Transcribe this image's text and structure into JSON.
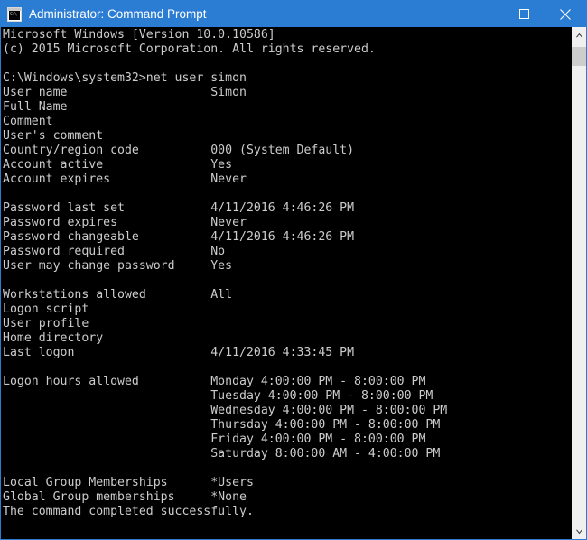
{
  "window": {
    "title": "Administrator: Command Prompt",
    "icon": "command-prompt-icon",
    "icon_glyph": "C:\\",
    "accent_color": "#2b7cd3",
    "terminal_bg": "#000000",
    "terminal_fg": "#cccccc",
    "controls": {
      "minimize_label": "Minimize",
      "maximize_label": "Maximize",
      "close_label": "Close"
    }
  },
  "scrollbar": {
    "up_arrow_label": "Scroll up",
    "down_arrow_label": "Scroll down",
    "thumb_label": "Scroll thumb"
  },
  "terminal": {
    "banner": [
      "Microsoft Windows [Version 10.0.10586]",
      "(c) 2015 Microsoft Corporation. All rights reserved."
    ],
    "prompt": "C:\\Windows\\system32>",
    "command": "net user simon",
    "fields": [
      {
        "label": "User name",
        "value": "Simon"
      },
      {
        "label": "Full Name",
        "value": ""
      },
      {
        "label": "Comment",
        "value": ""
      },
      {
        "label": "User's comment",
        "value": ""
      },
      {
        "label": "Country/region code",
        "value": "000 (System Default)"
      },
      {
        "label": "Account active",
        "value": "Yes"
      },
      {
        "label": "Account expires",
        "value": "Never"
      },
      {
        "label": "",
        "value": ""
      },
      {
        "label": "Password last set",
        "value": "4/11/2016 4:46:26 PM"
      },
      {
        "label": "Password expires",
        "value": "Never"
      },
      {
        "label": "Password changeable",
        "value": "4/11/2016 4:46:26 PM"
      },
      {
        "label": "Password required",
        "value": "No"
      },
      {
        "label": "User may change password",
        "value": "Yes"
      },
      {
        "label": "",
        "value": ""
      },
      {
        "label": "Workstations allowed",
        "value": "All"
      },
      {
        "label": "Logon script",
        "value": ""
      },
      {
        "label": "User profile",
        "value": ""
      },
      {
        "label": "Home directory",
        "value": ""
      },
      {
        "label": "Last logon",
        "value": "4/11/2016 4:33:45 PM"
      },
      {
        "label": "",
        "value": ""
      },
      {
        "label": "Logon hours allowed",
        "value": "Monday 4:00:00 PM - 8:00:00 PM"
      },
      {
        "label": "",
        "value": "Tuesday 4:00:00 PM - 8:00:00 PM"
      },
      {
        "label": "",
        "value": "Wednesday 4:00:00 PM - 8:00:00 PM"
      },
      {
        "label": "",
        "value": "Thursday 4:00:00 PM - 8:00:00 PM"
      },
      {
        "label": "",
        "value": "Friday 4:00:00 PM - 8:00:00 PM"
      },
      {
        "label": "",
        "value": "Saturday 8:00:00 AM - 4:00:00 PM"
      },
      {
        "label": "",
        "value": ""
      },
      {
        "label": "Local Group Memberships",
        "value": "*Users"
      },
      {
        "label": "Global Group memberships",
        "value": "*None"
      }
    ],
    "footer": "The command completed successfully.",
    "value_column": 29
  }
}
